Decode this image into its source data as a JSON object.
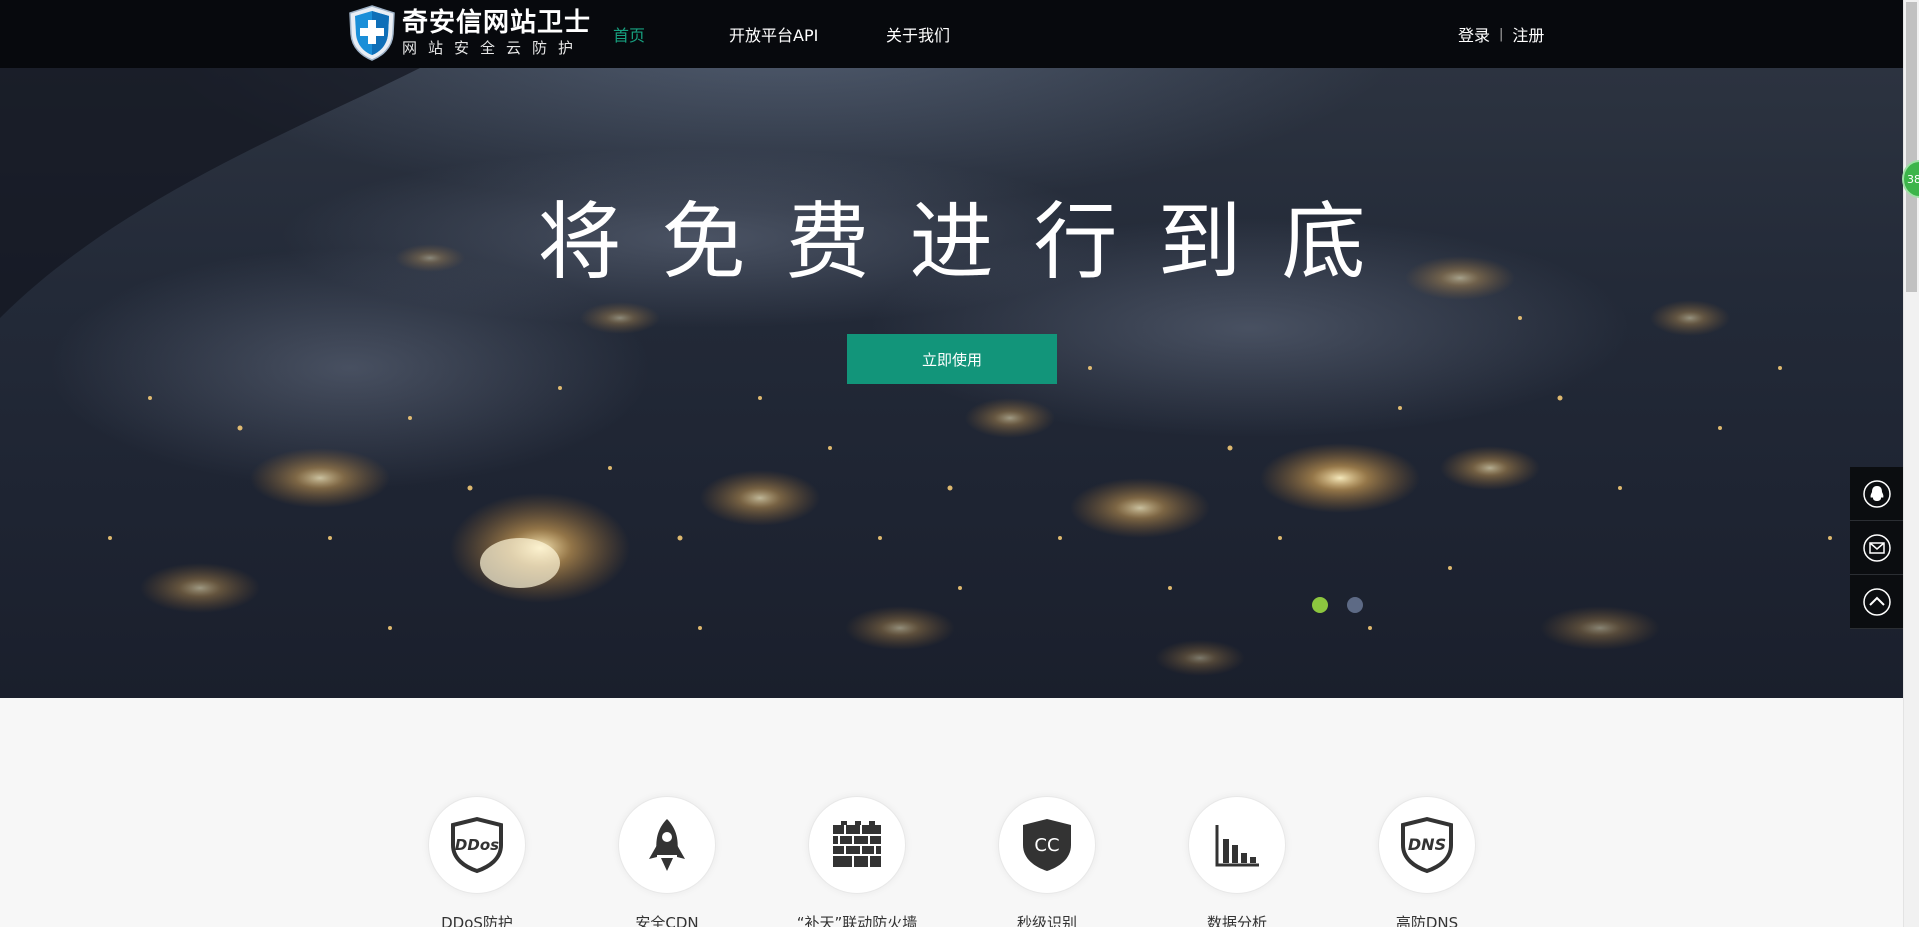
{
  "header": {
    "logo_title": "奇安信网站卫士",
    "logo_subtitle": "网站安全云防护",
    "nav": [
      {
        "label": "首页",
        "active": true
      },
      {
        "label": "开放平台API",
        "active": false
      },
      {
        "label": "关于我们",
        "active": false
      }
    ],
    "login_label": "登录",
    "separator": "|",
    "register_label": "注册"
  },
  "hero": {
    "title": "将免费进行到底",
    "cta_label": "立即使用",
    "slides_total": 2,
    "active_slide": 1
  },
  "side_tools": {
    "badge_text": "38",
    "items": [
      {
        "icon": "qq-penguin-icon"
      },
      {
        "icon": "mail-icon"
      },
      {
        "icon": "back-to-top-icon"
      }
    ]
  },
  "features": [
    {
      "label": "DDoS防护",
      "icon": "ddos-shield-icon"
    },
    {
      "label": "安全CDN",
      "icon": "rocket-icon"
    },
    {
      "label": "“补天”联动防火墙",
      "icon": "firewall-icon"
    },
    {
      "label": "秒级识别",
      "icon": "cc-shield-icon"
    },
    {
      "label": "数据分析",
      "icon": "bar-chart-icon"
    },
    {
      "label": "高防DNS",
      "icon": "dns-shield-icon"
    }
  ],
  "colors": {
    "accent": "#12957a",
    "active_nav": "#17a07f",
    "active_dot": "#8cc63f",
    "header_bg": "#07090d"
  }
}
